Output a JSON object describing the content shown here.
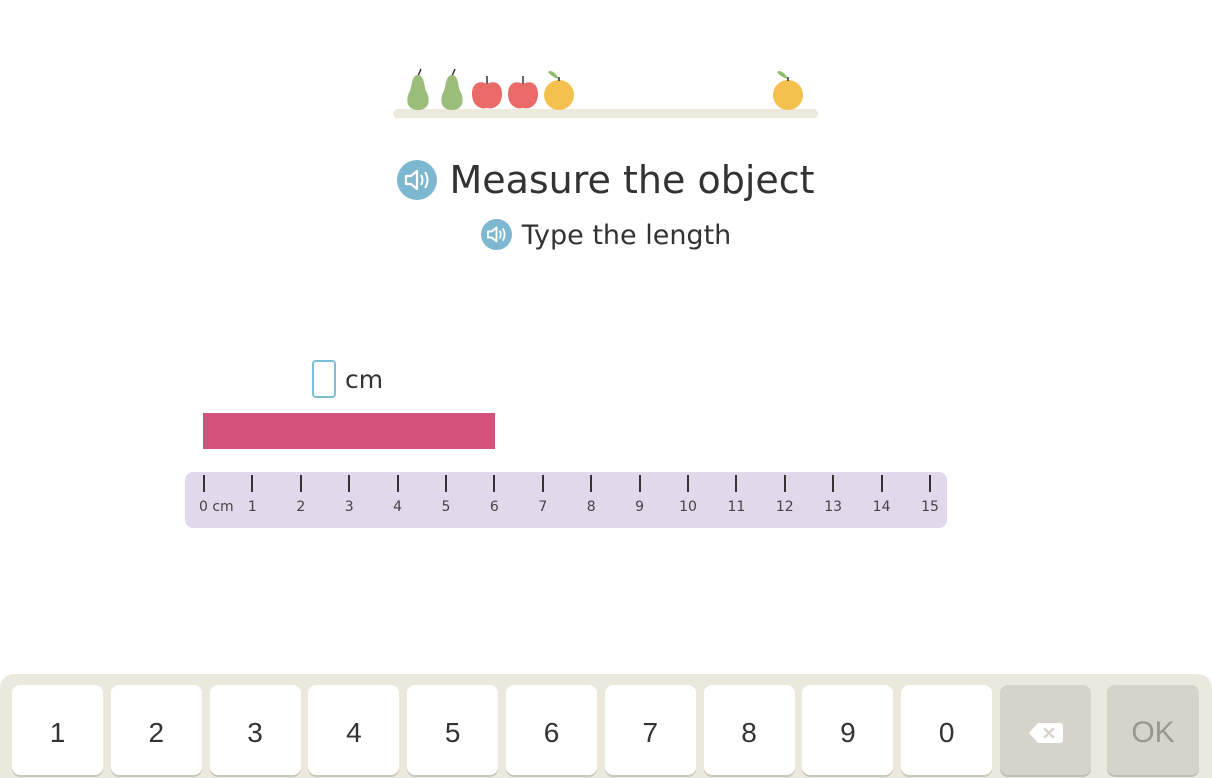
{
  "progress": {
    "fruits": [
      "pear",
      "pear",
      "apple",
      "apple",
      "orange"
    ],
    "goal_fruit": "orange",
    "completed_count": 5
  },
  "instructions": {
    "main": "Measure the object",
    "sub": "Type the length",
    "speaker_icon": "speaker-icon"
  },
  "answer": {
    "value": "",
    "unit": "cm"
  },
  "object": {
    "length": 6,
    "color": "#d2527c"
  },
  "ruler": {
    "labels": [
      "0 cm",
      "1",
      "2",
      "3",
      "4",
      "5",
      "6",
      "7",
      "8",
      "9",
      "10",
      "11",
      "12",
      "13",
      "14",
      "15"
    ],
    "color": "#e2d8eb"
  },
  "keypad": {
    "keys": [
      "1",
      "2",
      "3",
      "4",
      "5",
      "6",
      "7",
      "8",
      "9",
      "0"
    ],
    "backspace_icon": "backspace-icon",
    "ok_label": "OK"
  }
}
